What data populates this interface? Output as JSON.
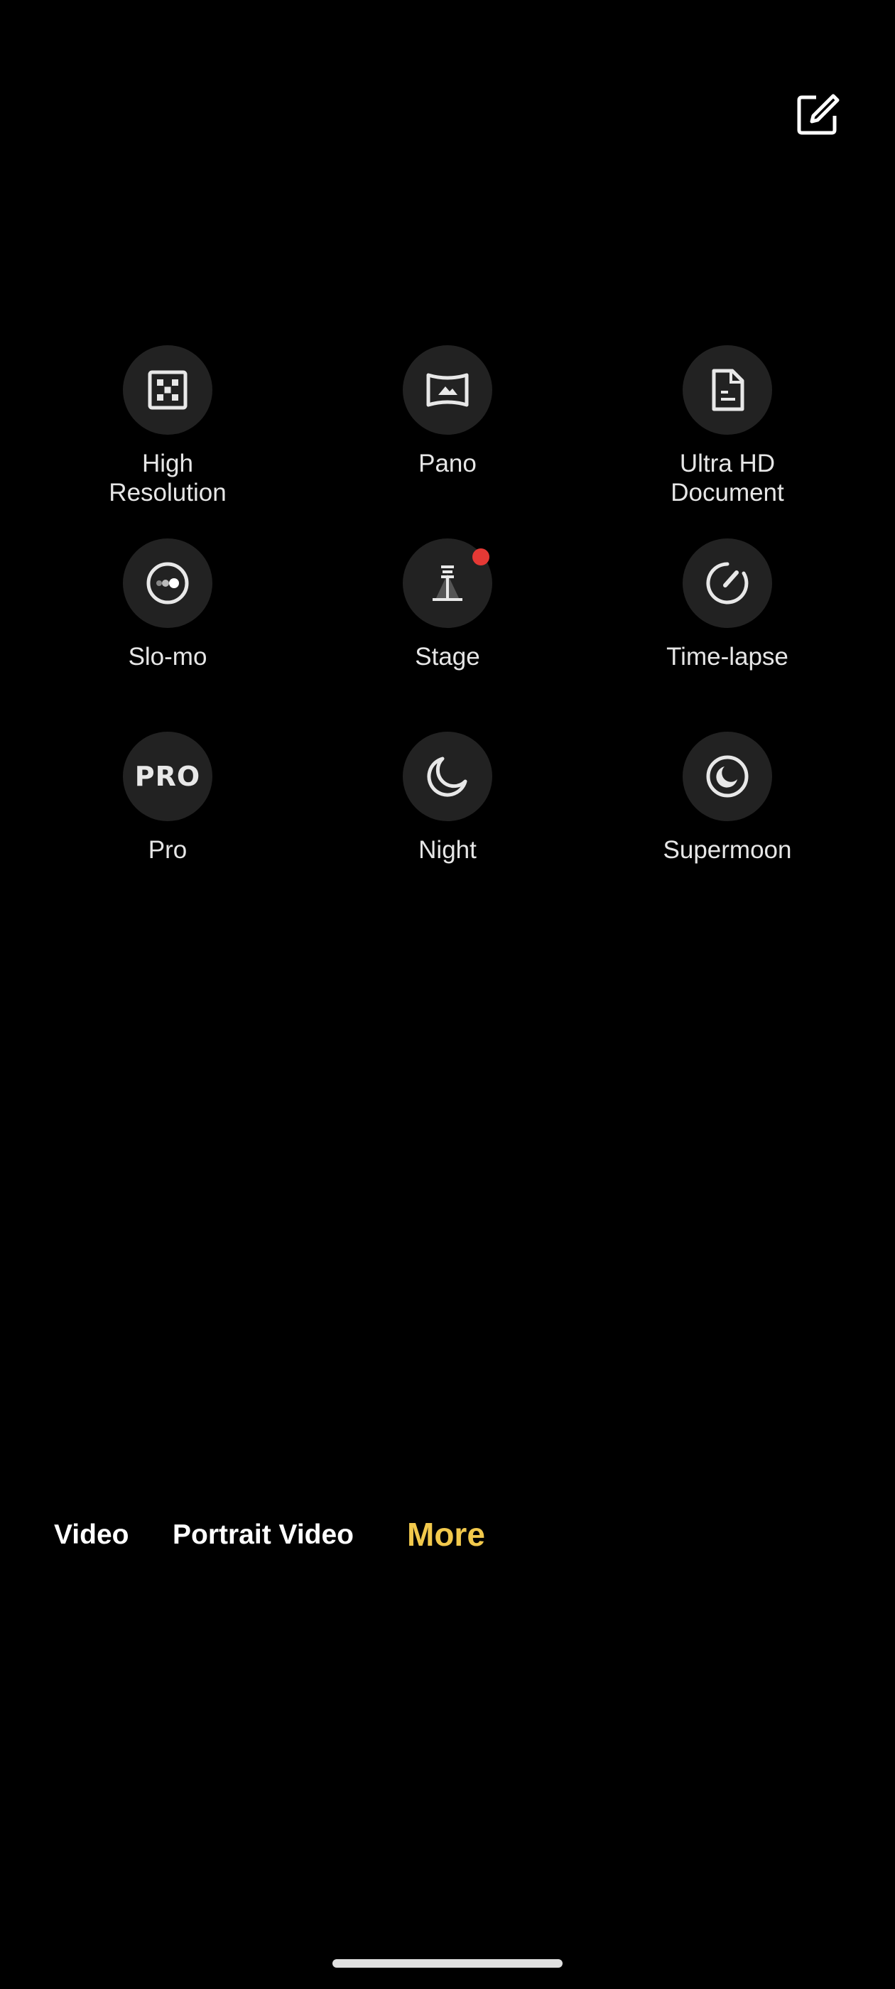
{
  "colors": {
    "background": "#000000",
    "icon_bg": "#222222",
    "accent": "#F2C94C",
    "badge": "#E53935",
    "text": "#E6E6E6"
  },
  "header": {
    "edit_icon": "edit-icon"
  },
  "modes": [
    {
      "label": "High\nResolution",
      "icon": "high-resolution-icon"
    },
    {
      "label": "Pano",
      "icon": "pano-icon"
    },
    {
      "label": "Ultra HD\nDocument",
      "icon": "document-icon"
    },
    {
      "label": "Slo-mo",
      "icon": "slo-mo-icon"
    },
    {
      "label": "Stage",
      "icon": "stage-icon",
      "badge": true
    },
    {
      "label": "Time-lapse",
      "icon": "time-lapse-icon"
    },
    {
      "label": "Pro",
      "icon": "pro-icon",
      "icon_text": "PRO"
    },
    {
      "label": "Night",
      "icon": "night-icon"
    },
    {
      "label": "Supermoon",
      "icon": "supermoon-icon"
    }
  ],
  "mode_bar": {
    "tabs": [
      {
        "label": "Video",
        "active": false
      },
      {
        "label": "Portrait Video",
        "active": false
      },
      {
        "label": "More",
        "active": true
      }
    ]
  }
}
